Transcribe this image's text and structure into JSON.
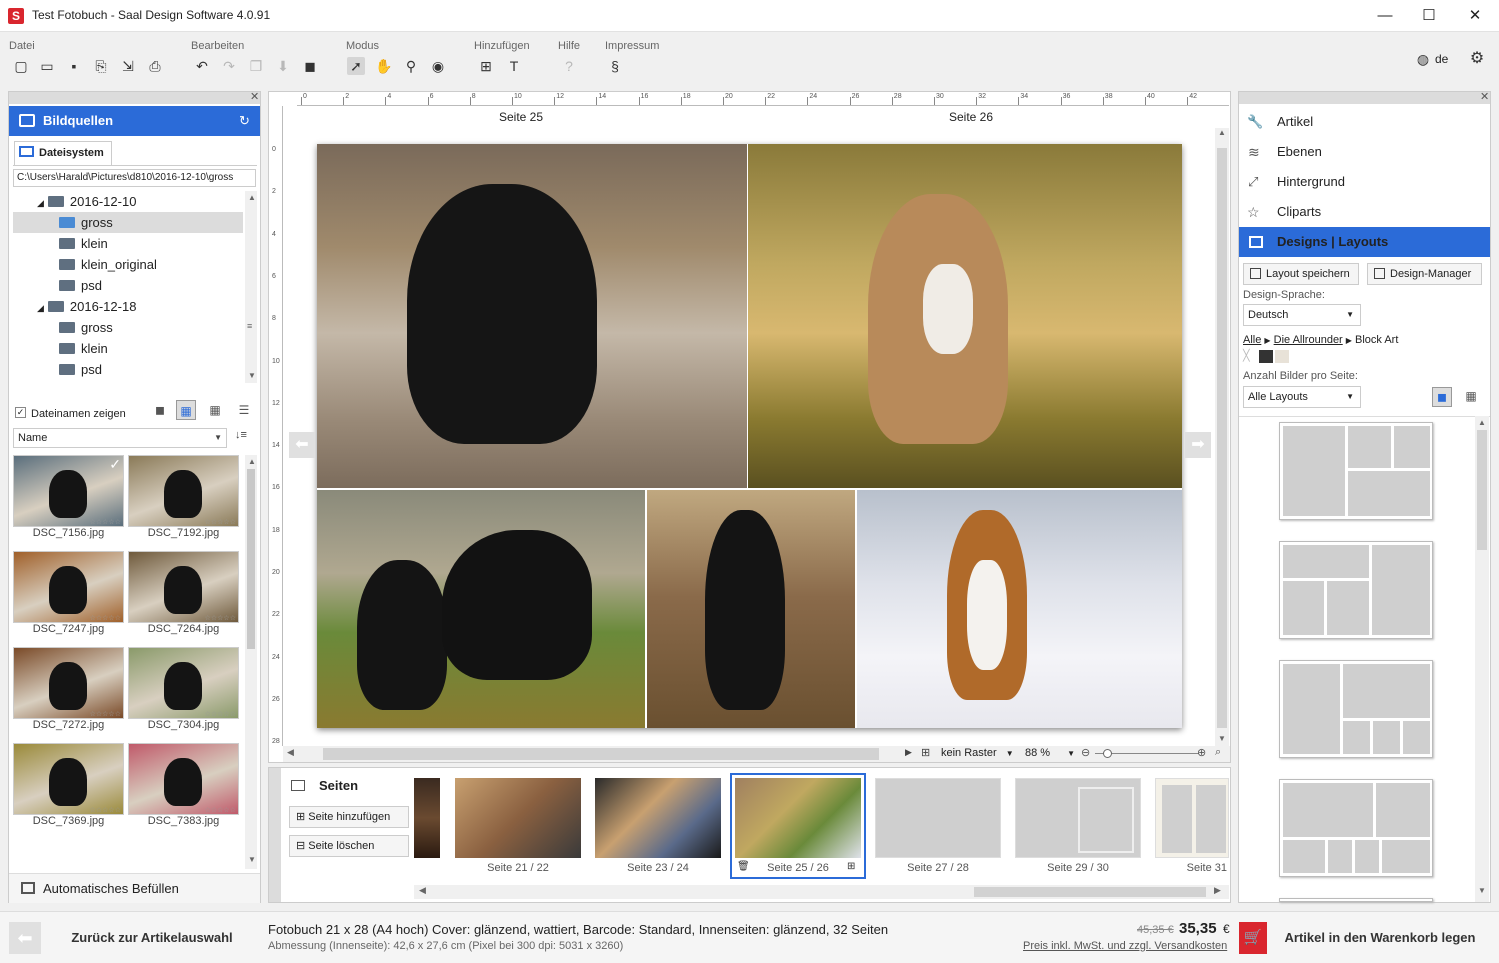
{
  "window": {
    "title": "Test Fotobuch - Saal Design Software 4.0.91",
    "minimize": "—",
    "maximize": "☐",
    "close": "✕"
  },
  "toolbar": {
    "groups": {
      "datei": "Datei",
      "bearbeiten": "Bearbeiten",
      "modus": "Modus",
      "hinzufuegen": "Hinzufügen",
      "hilfe": "Hilfe",
      "impressum": "Impressum"
    },
    "help_glyph": "?",
    "impressum_glyph": "§",
    "language": "de"
  },
  "left_panel": {
    "title": "Bildquellen",
    "tab": "Dateisystem",
    "path": "C:\\Users\\Harald\\Pictures\\d810\\2016-12-10\\gross",
    "tree": [
      {
        "label": "2016-12-10",
        "level": 1,
        "expanded": true
      },
      {
        "label": "gross",
        "level": 2,
        "selected": true
      },
      {
        "label": "klein",
        "level": 2
      },
      {
        "label": "klein_original",
        "level": 2
      },
      {
        "label": "psd",
        "level": 2
      },
      {
        "label": "2016-12-18",
        "level": 1,
        "expanded": true
      },
      {
        "label": "gross",
        "level": 2
      },
      {
        "label": "klein",
        "level": 2
      },
      {
        "label": "psd",
        "level": 2
      }
    ],
    "show_filenames_label": "Dateinamen zeigen",
    "sort_label": "Name",
    "thumbnails": [
      {
        "name": "DSC_7156.jpg",
        "color": "#5a6e7c"
      },
      {
        "name": "DSC_7192.jpg",
        "color": "#8a7a58"
      },
      {
        "name": "DSC_7247.jpg",
        "color": "#a0602a"
      },
      {
        "name": "DSC_7264.jpg",
        "color": "#6f5a3c"
      },
      {
        "name": "DSC_7272.jpg",
        "color": "#7a4a28"
      },
      {
        "name": "DSC_7304.jpg",
        "color": "#8a9a6a"
      },
      {
        "name": "DSC_7369.jpg",
        "color": "#9a8a3a"
      },
      {
        "name": "DSC_7383.jpg",
        "color": "#c05a6a"
      }
    ],
    "autofill_label": "Automatisches Befüllen",
    "stars": "☆☆☆☆☆"
  },
  "canvas": {
    "page_left": "Seite 25",
    "page_right": "Seite 26",
    "ruler_labels": [
      "0",
      "2",
      "4",
      "6",
      "8",
      "10",
      "12",
      "14",
      "16",
      "18",
      "20",
      "22",
      "24",
      "26",
      "28",
      "30",
      "32",
      "34",
      "36",
      "38",
      "40",
      "42"
    ],
    "vruler_labels": [
      "0",
      "2",
      "4",
      "6",
      "8",
      "10",
      "12",
      "14",
      "16",
      "18",
      "20",
      "22",
      "24",
      "26",
      "28"
    ],
    "raster_label": "kein Raster",
    "zoom": "88 %"
  },
  "pages_strip": {
    "title": "Seiten",
    "add_label": "Seite hinzufügen",
    "delete_label": "Seite löschen",
    "pages": [
      {
        "label": "Seite 21 / 22"
      },
      {
        "label": "Seite 23 / 24"
      },
      {
        "label": "Seite 25 / 26",
        "selected": true
      },
      {
        "label": "Seite 27 / 28"
      },
      {
        "label": "Seite 29 / 30"
      },
      {
        "label": "Seite 31"
      }
    ]
  },
  "right_panel": {
    "items": [
      {
        "label": "Artikel",
        "icon": "wrench-icon",
        "glyph": "🔧"
      },
      {
        "label": "Ebenen",
        "icon": "layers-icon",
        "glyph": "≋"
      },
      {
        "label": "Hintergrund",
        "icon": "background-icon",
        "glyph": "⤢"
      },
      {
        "label": "Cliparts",
        "icon": "star-icon",
        "glyph": "☆"
      }
    ],
    "active_item": "Designs | Layouts",
    "save_layout": "Layout speichern",
    "design_manager": "Design-Manager",
    "design_language_label": "Design-Sprache:",
    "design_language_value": "Deutsch",
    "breadcrumb": {
      "all": "Alle",
      "category": "Die Allrounder",
      "current": "Block Art"
    },
    "per_page_label": "Anzahl Bilder pro Seite:",
    "per_page_value": "Alle Layouts"
  },
  "status": {
    "back_label": "Zurück zur Artikelauswahl",
    "product": "Fotobuch 21 x 28 (A4 hoch) Cover: glänzend, wattiert, Barcode: Standard, Innenseiten: glänzend, 32 Seiten",
    "dimensions": "Abmessung (Innenseite): 42,6 x 27,6 cm (Pixel bei 300 dpi: 5031 x 3260)",
    "old_price": "45,35 €",
    "price": "35,35",
    "currency": "€",
    "price_note": "Preis inkl. MwSt. und zzgl. Versandkosten",
    "cart_label": "Artikel in den Warenkorb legen"
  },
  "colors": {
    "accent": "#2b6bd8",
    "cart": "#d9262e"
  }
}
